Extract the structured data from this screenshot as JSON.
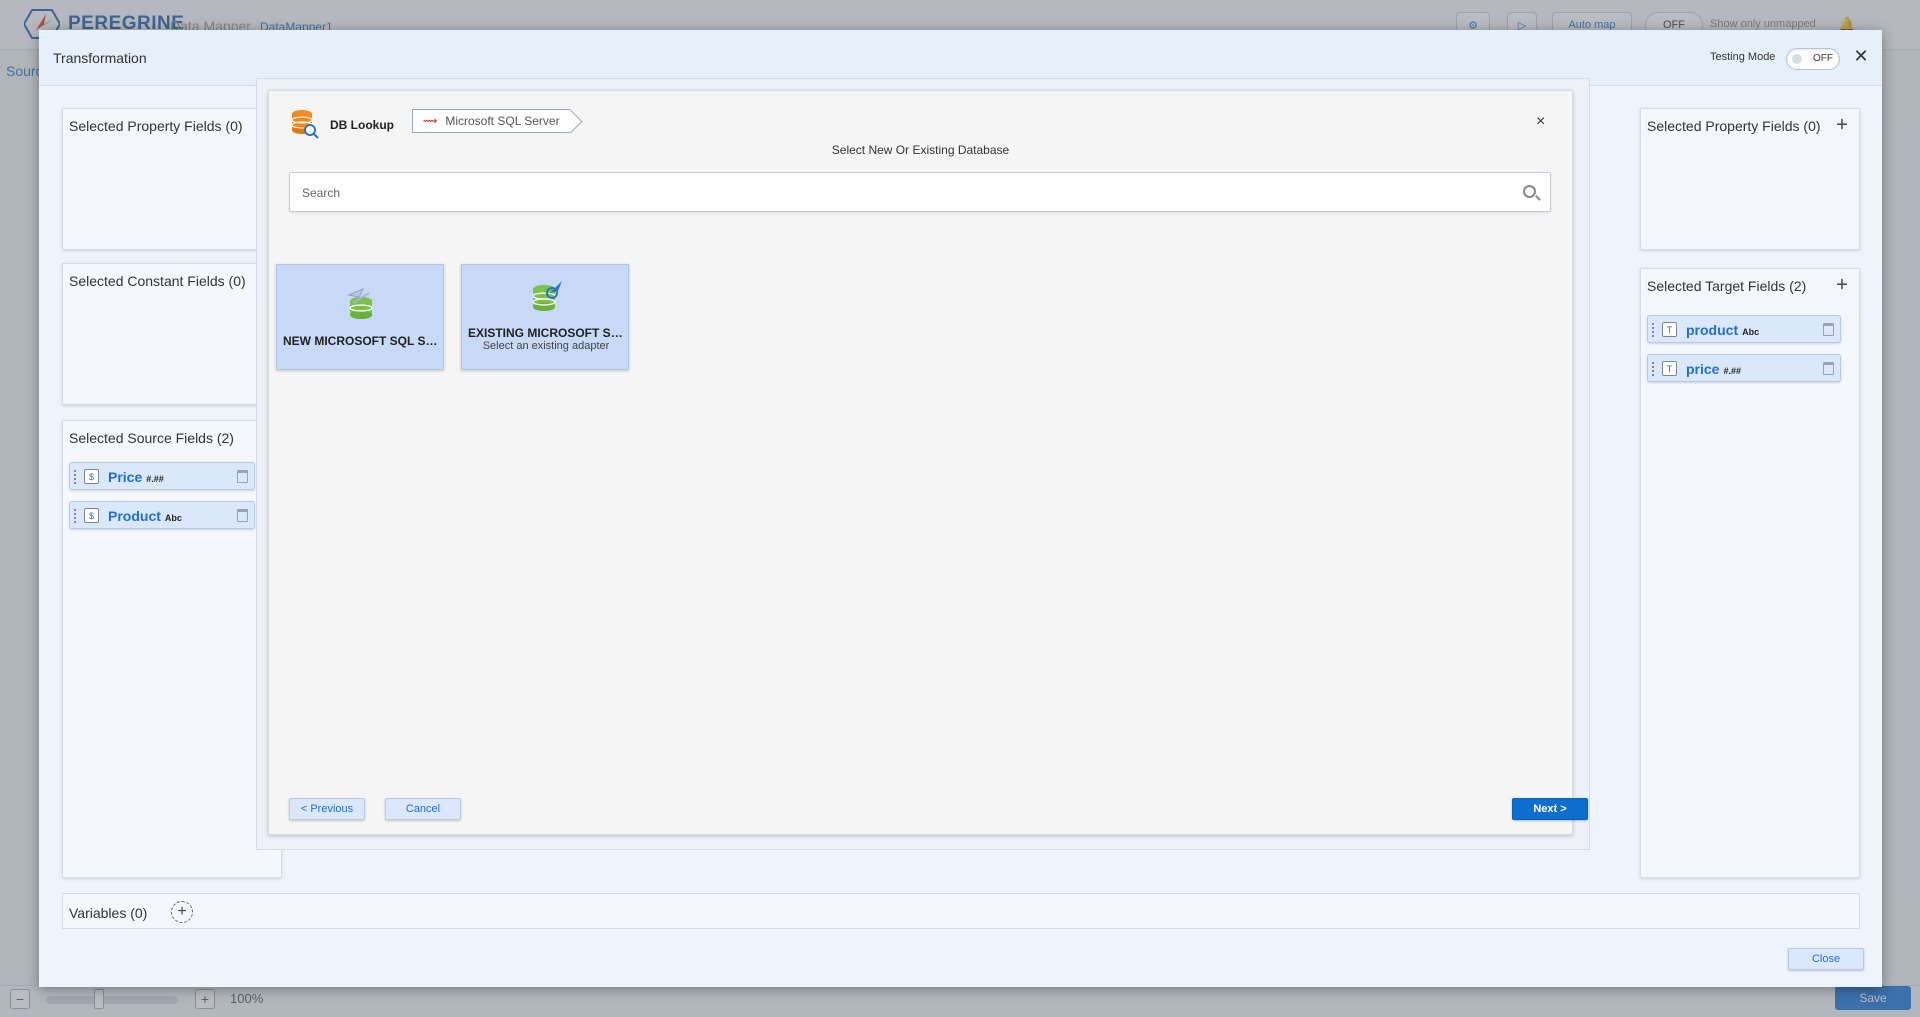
{
  "background": {
    "brand": "PEREGRINE",
    "app_name": "Data Mapper",
    "app_sub": "DataMapper1",
    "auto_map_label": "Auto map",
    "toggle_off_label": "OFF",
    "show_unmapped_label": "Show only unmapped",
    "left_tab": "Sourc",
    "zoom_label": "100%",
    "save_label": "Save"
  },
  "modal": {
    "title": "Transformation",
    "testing_mode_label": "Testing Mode",
    "testing_mode_state": "OFF",
    "close_label": "Close"
  },
  "left": {
    "property_title": "Selected Property Fields (0)",
    "constant_title": "Selected Constant Fields (0)",
    "source_title": "Selected Source Fields (2)",
    "source_fields": [
      {
        "name": "Price",
        "type": "#.##"
      },
      {
        "name": "Product",
        "type": "Abc"
      }
    ]
  },
  "right": {
    "property_title": "Selected Property Fields (0)",
    "target_title": "Selected Target Fields (2)",
    "target_fields": [
      {
        "name": "product",
        "type": "Abc"
      },
      {
        "name": "price",
        "type": "#.##"
      }
    ]
  },
  "lookup": {
    "title": "DB Lookup",
    "crumb": "Microsoft SQL Server",
    "subtitle": "Select New Or Existing Database",
    "search_placeholder": "Search",
    "options": [
      {
        "label": "NEW MICROSOFT SQL SERVER",
        "sub": ""
      },
      {
        "label": "EXISTING MICROSOFT SQL SERVER",
        "sub": "Select an existing adapter"
      }
    ],
    "previous_label": "< Previous",
    "cancel_label": "Cancel",
    "next_label": "Next >"
  },
  "variables": {
    "label": "Variables (0)"
  },
  "colors": {
    "primary": "#0f6fd1",
    "chip_bg": "#dbe8fb",
    "field_name": "#1f6fd0"
  }
}
